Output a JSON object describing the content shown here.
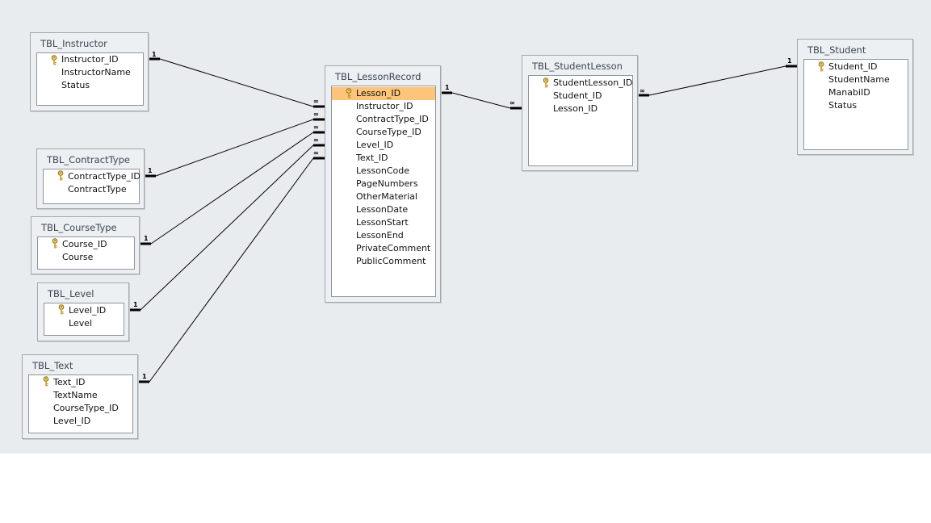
{
  "tables": {
    "instructor": {
      "name": "TBL_Instructor",
      "fields": [
        "Instructor_ID",
        "InstructorName",
        "Status"
      ]
    },
    "contract_type": {
      "name": "TBL_ContractType",
      "fields": [
        "ContractType_ID",
        "ContractType"
      ]
    },
    "course_type": {
      "name": "TBL_CourseType",
      "fields": [
        "Course_ID",
        "Course"
      ]
    },
    "level": {
      "name": "TBL_Level",
      "fields": [
        "Level_ID",
        "Level"
      ]
    },
    "text": {
      "name": "TBL_Text",
      "fields": [
        "Text_ID",
        "TextName",
        "CourseType_ID",
        "Level_ID"
      ]
    },
    "lesson_record": {
      "name": "TBL_LessonRecord",
      "fields": [
        "Lesson_ID",
        "Instructor_ID",
        "ContractType_ID",
        "CourseType_ID",
        "Level_ID",
        "Text_ID",
        "LessonCode",
        "PageNumbers",
        "OtherMaterial",
        "LessonDate",
        "LessonStart",
        "LessonEnd",
        "PrivateComment",
        "PublicComment"
      ]
    },
    "student_lesson": {
      "name": "TBL_StudentLesson",
      "fields": [
        "StudentLesson_ID",
        "Student_ID",
        "Lesson_ID"
      ]
    },
    "student": {
      "name": "TBL_Student",
      "fields": [
        "Student_ID",
        "StudentName",
        "ManabiID",
        "Status"
      ]
    }
  },
  "primary_key_icon": "key-icon",
  "selected_field": "Lesson_ID",
  "relationships": [
    {
      "from": "TBL_Instructor.Instructor_ID",
      "to": "TBL_LessonRecord",
      "one": "1",
      "many": "∞"
    },
    {
      "from": "TBL_ContractType.ContractType_ID",
      "to": "TBL_LessonRecord",
      "one": "1",
      "many": "∞"
    },
    {
      "from": "TBL_CourseType.Course_ID",
      "to": "TBL_LessonRecord",
      "one": "1",
      "many": "∞"
    },
    {
      "from": "TBL_Level.Level_ID",
      "to": "TBL_LessonRecord",
      "one": "1",
      "many": "∞"
    },
    {
      "from": "TBL_Text.Text_ID",
      "to": "TBL_LessonRecord",
      "one": "1",
      "many": "∞"
    },
    {
      "from": "TBL_LessonRecord.Lesson_ID",
      "to": "TBL_StudentLesson",
      "one": "1",
      "many": "∞"
    },
    {
      "from": "TBL_Student.Student_ID",
      "to": "TBL_StudentLesson",
      "one": "1",
      "many": "∞"
    }
  ],
  "colors": {
    "canvas": "#e9ecef",
    "selected_row": "#fdc47a",
    "line": "#000000"
  }
}
